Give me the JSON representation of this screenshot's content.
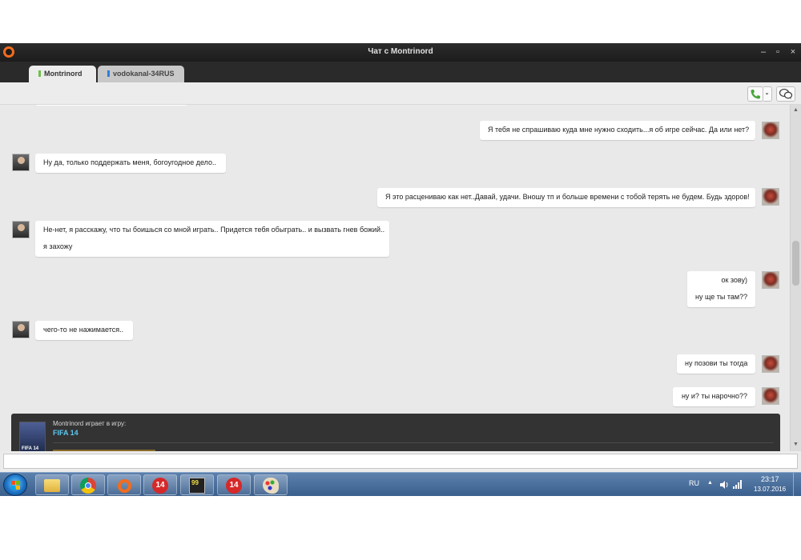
{
  "window": {
    "title": "Чат с Montrinord",
    "controls": {
      "minimize": "–",
      "restore": "▫",
      "close": "×"
    }
  },
  "tabs": [
    {
      "label": "Montrinord",
      "status_color": "#6cc04a",
      "active": true
    },
    {
      "label": "vodokanal-34RUS",
      "status_color": "#2f7fd8",
      "active": false
    }
  ],
  "toolbar": {
    "call_icon": "phone-icon",
    "dropdown_icon": "chevron-down-icon",
    "chat_icon": "chat-bubbles-icon"
  },
  "messages": [
    {
      "side": "right",
      "lines": [
        "Я тебя не спрашиваю куда мне нужно сходить...я об игре сейчас. Да или нет?"
      ]
    },
    {
      "side": "left",
      "lines": [
        "Ну да, только поддержать меня, богоугодное дело.."
      ]
    },
    {
      "side": "right",
      "lines": [
        "Я это расцениваю как нет..Давай, удачи. Вношу тп и больше времени с тобой терять не будем. Будь здоров!"
      ]
    },
    {
      "side": "left",
      "lines": [
        "Не-нет, я расскажу, что ты боишься со мной играть.. Придется тебя обыграть.. и вызвать гнев божий..",
        "я захожу"
      ]
    },
    {
      "side": "right",
      "lines": [
        "ок зову)",
        "ну ще ты там??"
      ]
    },
    {
      "side": "left",
      "lines": [
        "чего-то не нажимается.."
      ]
    },
    {
      "side": "right",
      "lines": [
        "ну позови ты тогда"
      ]
    },
    {
      "side": "right",
      "lines": [
        "ну и? ты нарочно??"
      ]
    }
  ],
  "game_activity": {
    "user_text": "Montrinord играет в игру:",
    "game": "FIFA 14",
    "cover_text": "FIFA 14",
    "accent_color": "#5cc8f0"
  },
  "input": {
    "value": "",
    "placeholder": ""
  },
  "taskbar": {
    "apps": [
      {
        "icon": "folder-icon"
      },
      {
        "icon": "chrome-icon"
      },
      {
        "icon": "origin-icon"
      },
      {
        "icon": "fifa14-icon",
        "label": "14"
      },
      {
        "icon": "monitor-icon",
        "label": "99"
      },
      {
        "icon": "fifa14-icon-2",
        "label": "14"
      },
      {
        "icon": "paint-icon"
      }
    ],
    "language": "RU",
    "time": "23:17",
    "date": "13.07.2016"
  }
}
